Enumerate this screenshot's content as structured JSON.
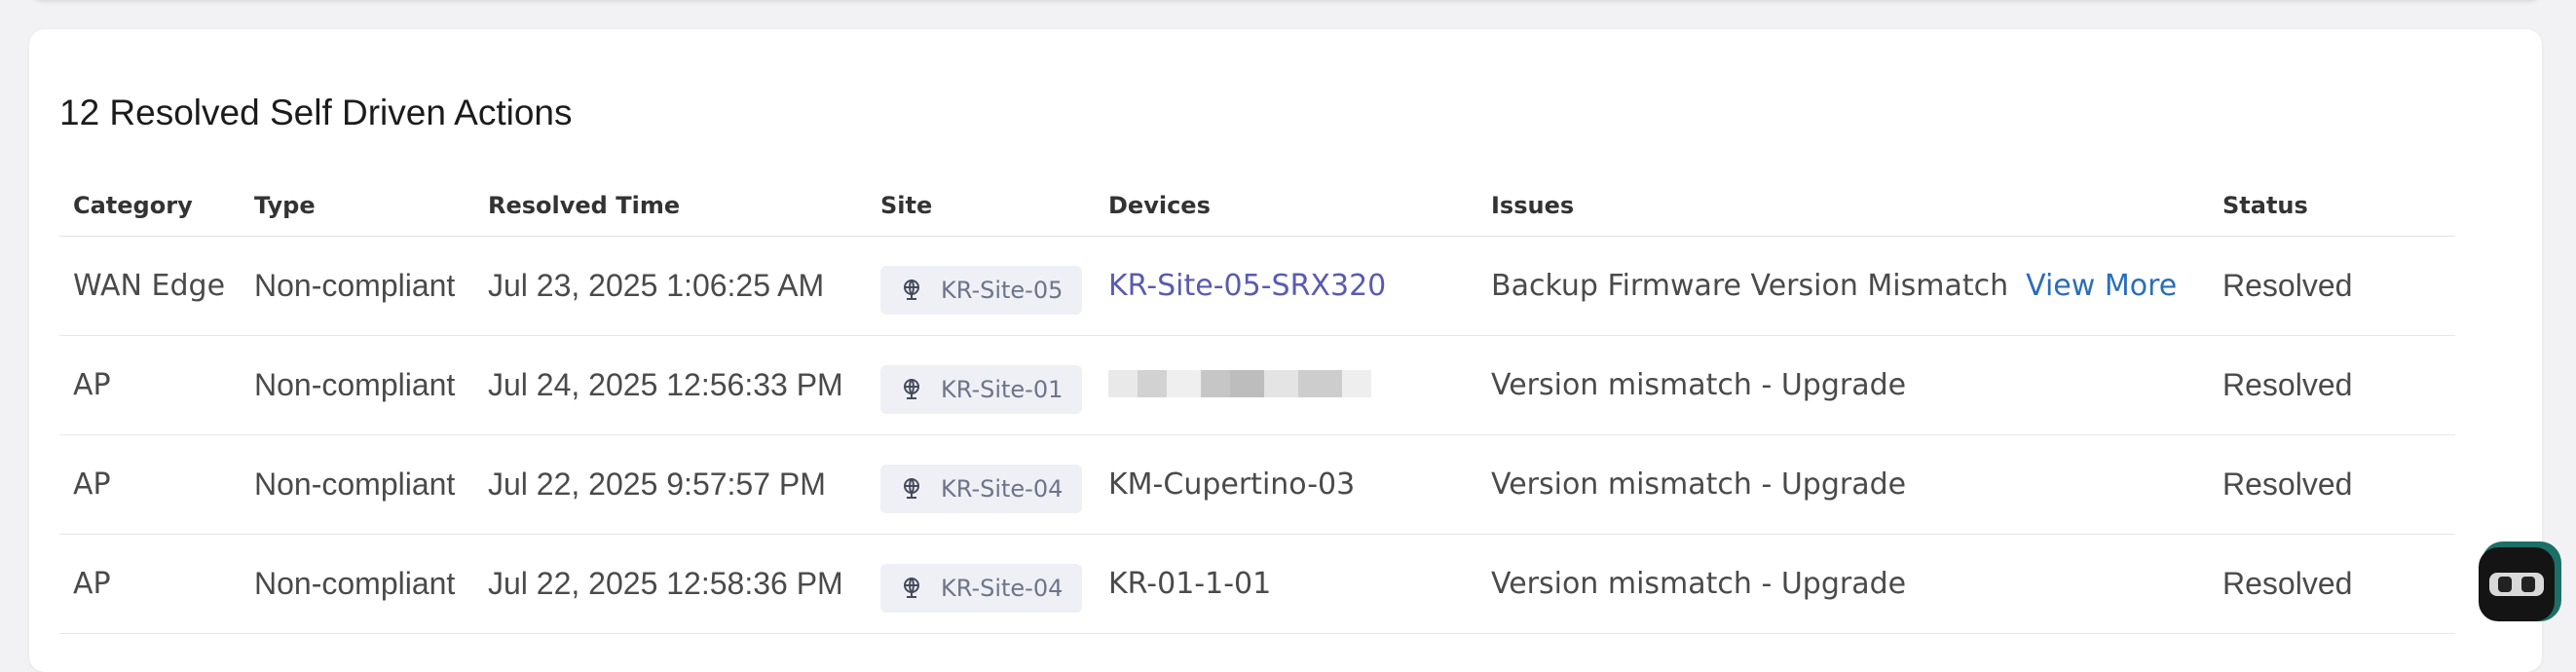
{
  "card": {
    "title": "12 Resolved Self Driven Actions"
  },
  "table": {
    "columns": {
      "category": "Category",
      "type": "Type",
      "resolved_time": "Resolved Time",
      "site": "Site",
      "devices": "Devices",
      "issues": "Issues",
      "status": "Status"
    },
    "rows": [
      {
        "category": "WAN Edge",
        "type": "Non-compliant",
        "resolved_time": "Jul 23, 2025 1:06:25 AM",
        "site": "KR-Site-05",
        "device": "KR-Site-05-SRX320",
        "issue": "Backup Firmware Version Mismatch",
        "action": "View More",
        "status": "Resolved"
      },
      {
        "category": "AP",
        "type": "Non-compliant",
        "resolved_time": "Jul 24, 2025 12:56:33 PM",
        "site": "KR-Site-01",
        "device": "",
        "issue": "Version mismatch - Upgrade",
        "status": "Resolved"
      },
      {
        "category": "AP",
        "type": "Non-compliant",
        "resolved_time": "Jul 22, 2025 9:57:57 PM",
        "site": "KR-Site-04",
        "device": "KM-Cupertino-03",
        "issue": "Version mismatch - Upgrade",
        "status": "Resolved"
      },
      {
        "category": "AP",
        "type": "Non-compliant",
        "resolved_time": "Jul 22, 2025 12:58:36 PM",
        "site": "KR-Site-04",
        "device": "KR-01-1-01",
        "issue": "Version mismatch - Upgrade",
        "status": "Resolved"
      }
    ]
  },
  "icons": {
    "site": "site-icon",
    "assistant": "assistant-bot-icon"
  },
  "colors": {
    "link": "#5a5bb0",
    "view_more": "#2a6ebb",
    "chip_bg": "#eef0f6",
    "bot_accent": "#1c6f67"
  }
}
